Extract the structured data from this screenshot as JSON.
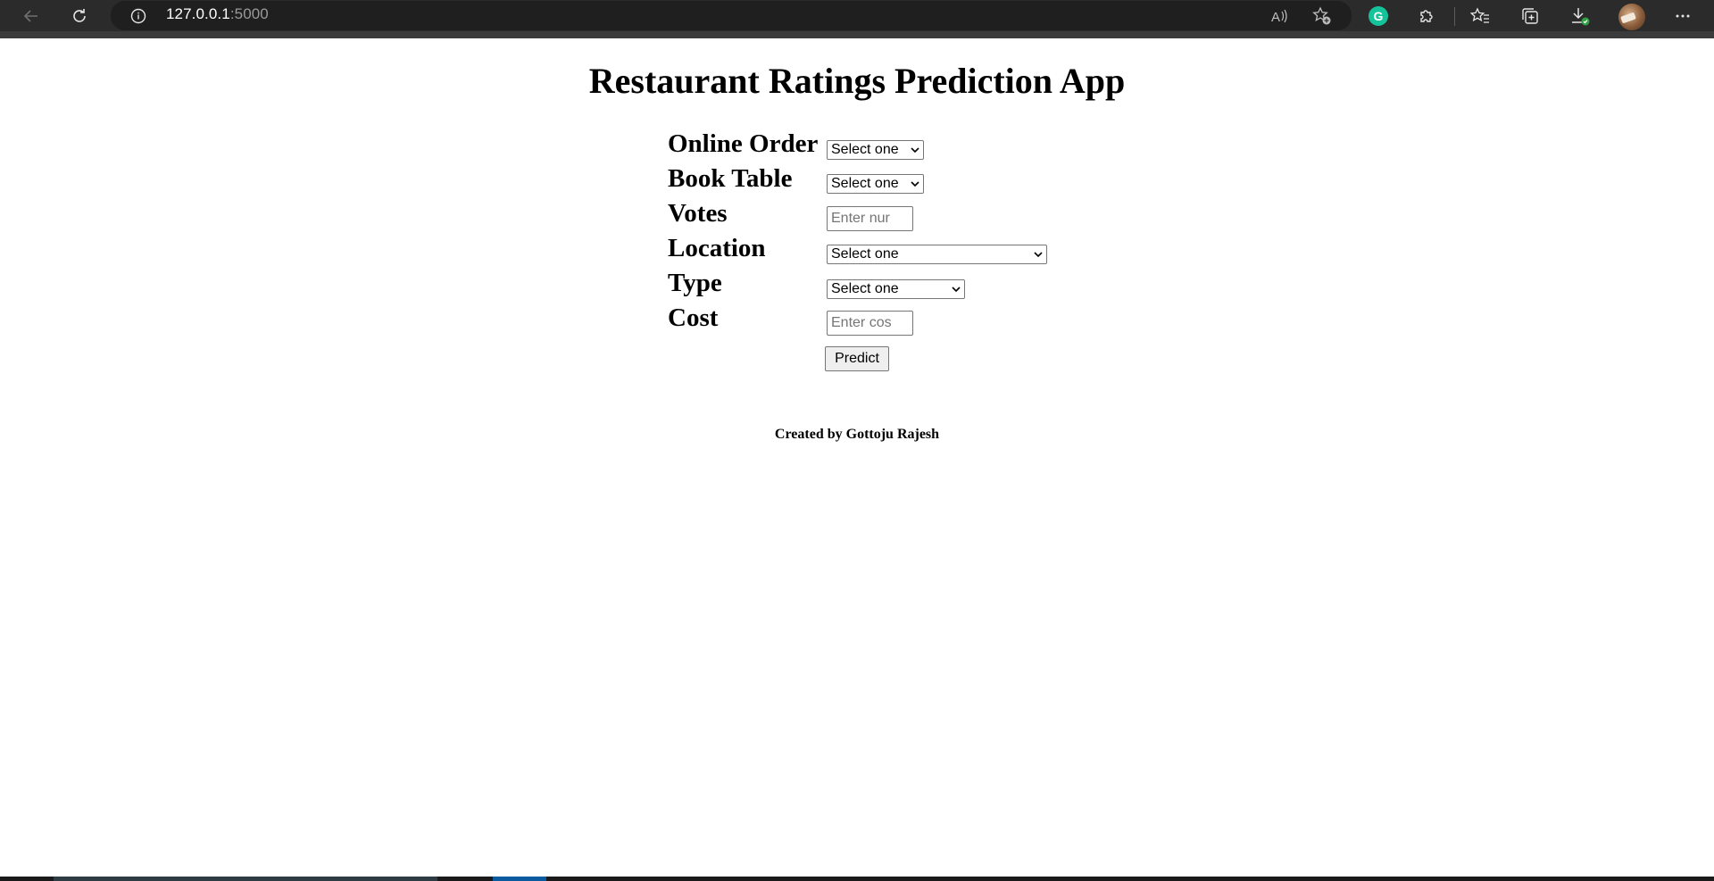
{
  "browser": {
    "url_host": "127.0.0.1",
    "url_port": ":5000"
  },
  "page": {
    "title": "Restaurant Ratings Prediction App",
    "footer": "Created by Gottoju Rajesh"
  },
  "form": {
    "online_order": {
      "label": "Online Order",
      "value": "Select one"
    },
    "book_table": {
      "label": "Book Table",
      "value": "Select one"
    },
    "votes": {
      "label": "Votes",
      "placeholder": "Enter nur"
    },
    "location": {
      "label": "Location",
      "value": "Select one"
    },
    "type": {
      "label": "Type",
      "value": "Select one"
    },
    "cost": {
      "label": "Cost",
      "placeholder": "Enter cos"
    },
    "submit_label": "Predict"
  }
}
